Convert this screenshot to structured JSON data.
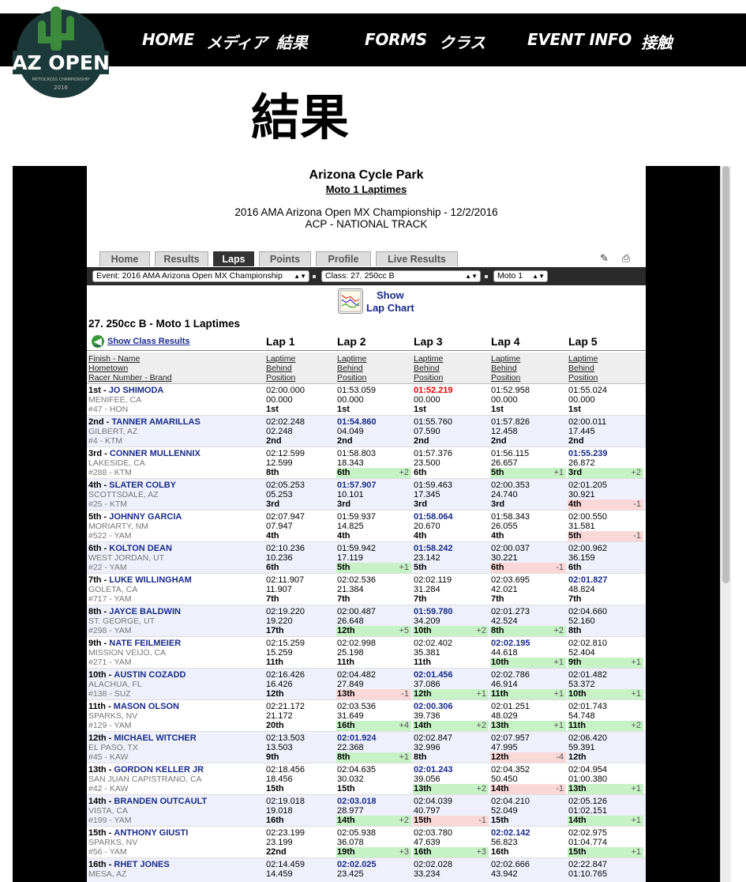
{
  "logo": {
    "text": "AZ OPEN",
    "sub": "MOTOCROSS CHAMPIONSHIP",
    "year": "2016"
  },
  "nav": {
    "home": "HOME",
    "media": "メディア",
    "results": "結果",
    "forms": "FORMS",
    "classes": "クラス",
    "event_info": "EVENT INFO",
    "contact": "接触"
  },
  "page_title": "結果",
  "venue": "Arizona Cycle Park",
  "subtitle": "Moto 1 Laptimes",
  "event_line1": "2016 AMA Arizona Open MX Championship - 12/2/2016",
  "event_line2": "ACP - NATIONAL TRACK",
  "tabs": [
    "Home",
    "Results",
    "Laps",
    "Points",
    "Profile",
    "Live Results"
  ],
  "active_tab": "Laps",
  "selects": {
    "event": "Event: 2016 AMA Arizona Open MX Championship",
    "class": "Class: 27. 250cc B",
    "moto": "Moto 1"
  },
  "lap_chart": {
    "line1": "Show",
    "line2": "Lap Chart"
  },
  "section_title": "27. 250cc B - Moto 1 Laptimes",
  "show_class_results": "Show Class Results",
  "laps": [
    "Lap 1",
    "Lap 2",
    "Lap 3",
    "Lap 4",
    "Lap 5"
  ],
  "col_header": {
    "rider": [
      "Finish - Name",
      "Hometown",
      "Racer Number - Brand"
    ],
    "lap": [
      "Laptime",
      "Behind",
      "Position"
    ]
  },
  "riders": [
    {
      "finish": "1st",
      "name": "JO SHIMODA",
      "hometown": "MENIFEE, CA",
      "bike": "#47 - HON",
      "laps": [
        {
          "t": "02:00.000",
          "b": "00.000",
          "p": "1st"
        },
        {
          "t": "01:53.059",
          "b": "00.000",
          "p": "1st"
        },
        {
          "t": "01:52.219",
          "b": "00.000",
          "p": "1st",
          "s": "fast"
        },
        {
          "t": "01:52.958",
          "b": "00.000",
          "p": "1st"
        },
        {
          "t": "01:55.024",
          "b": "00.000",
          "p": "1st"
        }
      ]
    },
    {
      "finish": "2nd",
      "name": "TANNER AMARILLAS",
      "hometown": "GILBERT, AZ",
      "bike": "#4 - KTM",
      "laps": [
        {
          "t": "02:02.248",
          "b": "02.248",
          "p": "2nd"
        },
        {
          "t": "01:54.860",
          "b": "04.049",
          "p": "2nd",
          "s": "best"
        },
        {
          "t": "01:55.760",
          "b": "07.590",
          "p": "2nd"
        },
        {
          "t": "01:57.826",
          "b": "12.458",
          "p": "2nd"
        },
        {
          "t": "02:00.011",
          "b": "17.445",
          "p": "2nd"
        }
      ]
    },
    {
      "finish": "3rd",
      "name": "CONNER MULLENNIX",
      "hometown": "LAKESIDE, CA",
      "bike": "#288 - KTM",
      "laps": [
        {
          "t": "02:12.599",
          "b": "12.599",
          "p": "8th"
        },
        {
          "t": "01:58.803",
          "b": "18.343",
          "p": "6th",
          "c": "up",
          "d": "+2"
        },
        {
          "t": "01:57.376",
          "b": "23.500",
          "p": "6th"
        },
        {
          "t": "01:56.115",
          "b": "26.657",
          "p": "5th",
          "c": "up",
          "d": "+1"
        },
        {
          "t": "01:55.239",
          "b": "26.872",
          "p": "3rd",
          "c": "up",
          "d": "+2",
          "s": "best"
        }
      ]
    },
    {
      "finish": "4th",
      "name": "SLATER COLBY",
      "hometown": "SCOTTSDALE, AZ",
      "bike": "#25 - KTM",
      "laps": [
        {
          "t": "02:05.253",
          "b": "05.253",
          "p": "3rd"
        },
        {
          "t": "01:57.907",
          "b": "10.101",
          "p": "3rd",
          "s": "best"
        },
        {
          "t": "01:59.463",
          "b": "17.345",
          "p": "3rd"
        },
        {
          "t": "02:00.353",
          "b": "24.740",
          "p": "3rd"
        },
        {
          "t": "02:01.205",
          "b": "30.921",
          "p": "4th",
          "c": "dn",
          "d": "-1"
        }
      ]
    },
    {
      "finish": "5th",
      "name": "JOHNNY GARCIA",
      "hometown": "MORIARTY, NM",
      "bike": "#522 - YAM",
      "laps": [
        {
          "t": "02:07.947",
          "b": "07.947",
          "p": "4th"
        },
        {
          "t": "01:59.937",
          "b": "14.825",
          "p": "4th"
        },
        {
          "t": "01:58.064",
          "b": "20.670",
          "p": "4th",
          "s": "best"
        },
        {
          "t": "01:58.343",
          "b": "26.055",
          "p": "4th"
        },
        {
          "t": "02:00.550",
          "b": "31.581",
          "p": "5th",
          "c": "dn",
          "d": "-1"
        }
      ]
    },
    {
      "finish": "6th",
      "name": "KOLTON DEAN",
      "hometown": "WEST JORDAN, UT",
      "bike": "#22 - YAM",
      "laps": [
        {
          "t": "02:10.236",
          "b": "10.236",
          "p": "6th"
        },
        {
          "t": "01:59.942",
          "b": "17.119",
          "p": "5th",
          "c": "up",
          "d": "+1"
        },
        {
          "t": "01:58.242",
          "b": "23.142",
          "p": "5th",
          "s": "best"
        },
        {
          "t": "02:00.037",
          "b": "30.221",
          "p": "6th",
          "c": "dn",
          "d": "-1"
        },
        {
          "t": "02:00.962",
          "b": "36.159",
          "p": "6th"
        }
      ]
    },
    {
      "finish": "7th",
      "name": "LUKE WILLINGHAM",
      "hometown": "GOLETA, CA",
      "bike": "#717 - YAM",
      "laps": [
        {
          "t": "02:11.907",
          "b": "11.907",
          "p": "7th"
        },
        {
          "t": "02:02.536",
          "b": "21.384",
          "p": "7th"
        },
        {
          "t": "02:02.119",
          "b": "31.284",
          "p": "7th"
        },
        {
          "t": "02:03.695",
          "b": "42.021",
          "p": "7th"
        },
        {
          "t": "02:01.827",
          "b": "48.824",
          "p": "7th",
          "s": "best"
        }
      ]
    },
    {
      "finish": "8th",
      "name": "JAYCE BALDWIN",
      "hometown": "ST. GEORGE, UT",
      "bike": "#298 - YAM",
      "laps": [
        {
          "t": "02:19.220",
          "b": "19.220",
          "p": "17th"
        },
        {
          "t": "02:00.487",
          "b": "26.648",
          "p": "12th",
          "c": "up",
          "d": "+5"
        },
        {
          "t": "01:59.780",
          "b": "34.209",
          "p": "10th",
          "c": "up",
          "d": "+2",
          "s": "best"
        },
        {
          "t": "02:01.273",
          "b": "42.524",
          "p": "8th",
          "c": "up",
          "d": "+2"
        },
        {
          "t": "02:04.660",
          "b": "52.160",
          "p": "8th"
        }
      ]
    },
    {
      "finish": "9th",
      "name": "NATE FEILMEIER",
      "hometown": "MISSION VEIJO, CA",
      "bike": "#271 - YAM",
      "laps": [
        {
          "t": "02:15.259",
          "b": "15.259",
          "p": "11th"
        },
        {
          "t": "02:02.998",
          "b": "25.198",
          "p": "11th"
        },
        {
          "t": "02:02.402",
          "b": "35.381",
          "p": "11th"
        },
        {
          "t": "02:02.195",
          "b": "44.618",
          "p": "10th",
          "c": "up",
          "d": "+1",
          "s": "best"
        },
        {
          "t": "02:02.810",
          "b": "52.404",
          "p": "9th",
          "c": "up",
          "d": "+1"
        }
      ]
    },
    {
      "finish": "10th",
      "name": "AUSTIN COZADD",
      "hometown": "ALACHUA, FL",
      "bike": "#138 - SUZ",
      "laps": [
        {
          "t": "02:16.426",
          "b": "16.426",
          "p": "12th"
        },
        {
          "t": "02:04.482",
          "b": "27.849",
          "p": "13th",
          "c": "dn",
          "d": "-1"
        },
        {
          "t": "02:01.456",
          "b": "37.086",
          "p": "12th",
          "c": "up",
          "d": "+1",
          "s": "best"
        },
        {
          "t": "02:02.786",
          "b": "46.914",
          "p": "11th",
          "c": "up",
          "d": "+1"
        },
        {
          "t": "02:01.482",
          "b": "53.372",
          "p": "10th",
          "c": "up",
          "d": "+1"
        }
      ]
    },
    {
      "finish": "11th",
      "name": "MASON OLSON",
      "hometown": "SPARKS, NV",
      "bike": "#129 - YAM",
      "laps": [
        {
          "t": "02:21.172",
          "b": "21.172",
          "p": "20th"
        },
        {
          "t": "02:03.536",
          "b": "31.649",
          "p": "16th",
          "c": "up",
          "d": "+4"
        },
        {
          "t": "02:00.306",
          "b": "39.736",
          "p": "14th",
          "c": "up",
          "d": "+2",
          "s": "best"
        },
        {
          "t": "02:01.251",
          "b": "48.029",
          "p": "13th",
          "c": "up",
          "d": "+1"
        },
        {
          "t": "02:01.743",
          "b": "54.748",
          "p": "11th",
          "c": "up",
          "d": "+2"
        }
      ]
    },
    {
      "finish": "12th",
      "name": "MICHAEL WITCHER",
      "hometown": "EL PASO, TX",
      "bike": "#45 - KAW",
      "laps": [
        {
          "t": "02:13.503",
          "b": "13.503",
          "p": "9th"
        },
        {
          "t": "02:01.924",
          "b": "22.368",
          "p": "8th",
          "c": "up",
          "d": "+1",
          "s": "best"
        },
        {
          "t": "02:02.847",
          "b": "32.996",
          "p": "8th"
        },
        {
          "t": "02:07.957",
          "b": "47.995",
          "p": "12th",
          "c": "dn",
          "d": "-4"
        },
        {
          "t": "02:06.420",
          "b": "59.391",
          "p": "12th"
        }
      ]
    },
    {
      "finish": "13th",
      "name": "GORDON KELLER JR",
      "hometown": "SAN JUAN CAPISTRANO, CA",
      "bike": "#42 - KAW",
      "laps": [
        {
          "t": "02:18.456",
          "b": "18.456",
          "p": "15th"
        },
        {
          "t": "02:04.635",
          "b": "30.032",
          "p": "15th"
        },
        {
          "t": "02:01.243",
          "b": "39.056",
          "p": "13th",
          "c": "up",
          "d": "+2",
          "s": "best"
        },
        {
          "t": "02:04.352",
          "b": "50.450",
          "p": "14th",
          "c": "dn",
          "d": "-1"
        },
        {
          "t": "02:04.954",
          "b": "01:00.380",
          "p": "13th",
          "c": "up",
          "d": "+1"
        }
      ]
    },
    {
      "finish": "14th",
      "name": "BRANDEN OUTCAULT",
      "hometown": "VISTA, CA",
      "bike": "#199 - YAM",
      "laps": [
        {
          "t": "02:19.018",
          "b": "19.018",
          "p": "16th"
        },
        {
          "t": "02:03.018",
          "b": "28.977",
          "p": "14th",
          "c": "up",
          "d": "+2",
          "s": "best"
        },
        {
          "t": "02:04.039",
          "b": "40.797",
          "p": "15th",
          "c": "dn",
          "d": "-1"
        },
        {
          "t": "02:04.210",
          "b": "52.049",
          "p": "15th"
        },
        {
          "t": "02:05.126",
          "b": "01:02.151",
          "p": "14th",
          "c": "up",
          "d": "+1"
        }
      ]
    },
    {
      "finish": "15th",
      "name": "ANTHONY GIUSTI",
      "hometown": "SPARKS, NV",
      "bike": "#56 - YAM",
      "laps": [
        {
          "t": "02:23.199",
          "b": "23.199",
          "p": "22nd"
        },
        {
          "t": "02:05.938",
          "b": "36.078",
          "p": "19th",
          "c": "up",
          "d": "+3"
        },
        {
          "t": "02:03.780",
          "b": "47.639",
          "p": "16th",
          "c": "up",
          "d": "+3"
        },
        {
          "t": "02:02.142",
          "b": "56.823",
          "p": "16th",
          "s": "best"
        },
        {
          "t": "02:02.975",
          "b": "01:04.774",
          "p": "15th",
          "c": "up",
          "d": "+1"
        }
      ]
    },
    {
      "finish": "16th",
      "name": "RHET JONES",
      "hometown": "MESA, AZ",
      "bike": "",
      "laps": [
        {
          "t": "02:14.459",
          "b": "14.459",
          "p": ""
        },
        {
          "t": "02:02.025",
          "b": "23.425",
          "p": "",
          "s": "best"
        },
        {
          "t": "02:02.028",
          "b": "33.234",
          "p": ""
        },
        {
          "t": "02:02.666",
          "b": "43.942",
          "p": ""
        },
        {
          "t": "02:22.847",
          "b": "01:10.765",
          "p": ""
        }
      ]
    }
  ]
}
